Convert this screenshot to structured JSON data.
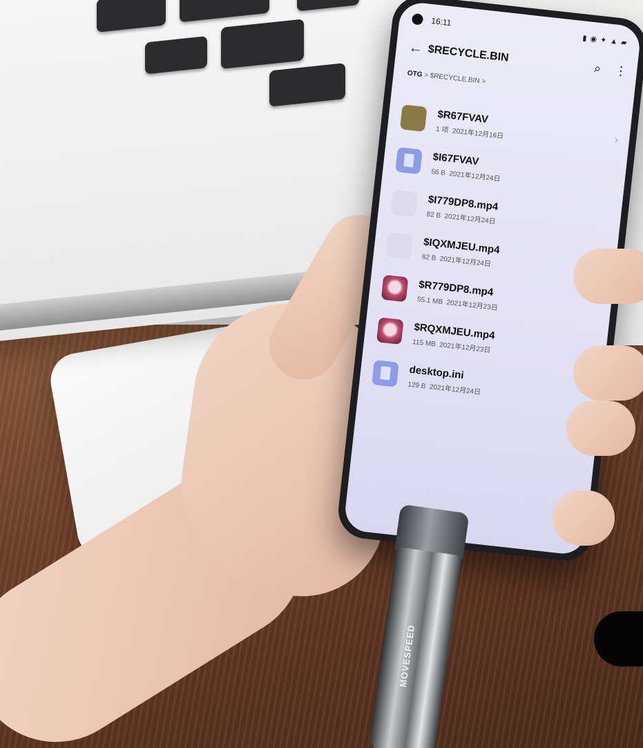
{
  "status": {
    "time": "16:11"
  },
  "appbar": {
    "title": "$RECYCLE.BIN"
  },
  "breadcrumb": {
    "root": "OTG",
    "separator": ">",
    "current": "$RECYCLE.BIN",
    "trail": ">"
  },
  "files": [
    {
      "name": "$R67FVAV",
      "size": "1 项",
      "date": "2021年12月16日",
      "icon": "folder-icon"
    },
    {
      "name": "$I67FVAV",
      "size": "56 B",
      "date": "2021年12月24日",
      "icon": "document-icon"
    },
    {
      "name": "$I779DP8.mp4",
      "size": "82 B",
      "date": "2021年12月24日",
      "icon": "document-icon"
    },
    {
      "name": "$IQXMJEU.mp4",
      "size": "82 B",
      "date": "2021年12月24日",
      "icon": "document-icon"
    },
    {
      "name": "$R779DP8.mp4",
      "size": "55.1 MB",
      "date": "2021年12月23日",
      "icon": "video-thumbnail-icon"
    },
    {
      "name": "$RQXMJEU.mp4",
      "size": "115 MB",
      "date": "2021年12月23日",
      "icon": "video-thumbnail-icon"
    },
    {
      "name": "desktop.ini",
      "size": "129 B",
      "date": "2021年12月24日",
      "icon": "document-icon"
    }
  ],
  "usb": {
    "brand": "MOVESPEED"
  }
}
